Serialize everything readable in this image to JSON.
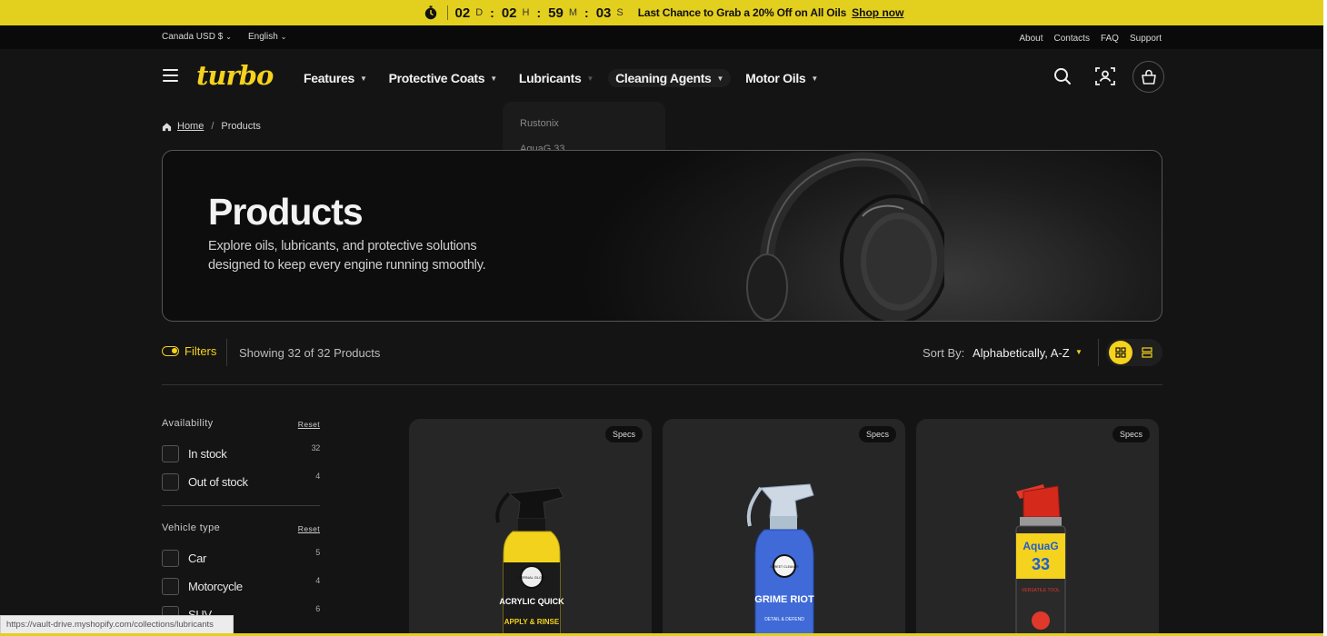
{
  "announcement": {
    "days": "02",
    "days_unit": "D",
    "hours": "02",
    "hours_unit": "H",
    "minutes": "59",
    "minutes_unit": "M",
    "seconds": "03",
    "seconds_unit": "S",
    "message": "Last Chance to Grab a 20% Off on All Oils",
    "cta": "Shop now"
  },
  "utility": {
    "currency": "Canada USD $",
    "language": "English",
    "links": [
      "About",
      "Contacts",
      "FAQ",
      "Support"
    ]
  },
  "nav": {
    "logo": "turbo",
    "items": [
      "Features",
      "Protective Coats",
      "Lubricants",
      "Cleaning Agents",
      "Motor Oils"
    ],
    "dropdown": [
      "Rustonix",
      "AquaG 33"
    ]
  },
  "breadcrumb": {
    "home": "Home",
    "separator": "/",
    "current": "Products"
  },
  "hero": {
    "title": "Products",
    "description": "Explore oils, lubricants, and protective solutions designed to keep every engine running smoothly."
  },
  "toolbar": {
    "filters_label": "Filters",
    "showing": "Showing 32 of 32 Products",
    "sort_label": "Sort By:",
    "sort_value": "Alphabetically, A-Z"
  },
  "filters": [
    {
      "title": "Availability",
      "reset": "Reset",
      "options": [
        {
          "label": "In stock",
          "count": "32"
        },
        {
          "label": "Out of stock",
          "count": "4"
        }
      ]
    },
    {
      "title": "Vehicle type",
      "reset": "Reset",
      "options": [
        {
          "label": "Car",
          "count": "5"
        },
        {
          "label": "Motorcycle",
          "count": "4"
        },
        {
          "label": "SUV",
          "count": "6"
        }
      ]
    }
  ],
  "products": [
    {
      "badge": "Specs",
      "brand_text": "ETERNAL GLOSS",
      "name_text": "ACRYLIC QUICK",
      "tag_text": "APPLY & RINSE",
      "color": "#f2d21c"
    },
    {
      "badge": "Specs",
      "brand_text": "STREET CLEANER",
      "name_text": "GRIME RIOT",
      "tag_text": "DETAIL & DEFEND",
      "color": "#3f6ad8"
    },
    {
      "badge": "Specs",
      "brand_text": "AquaG",
      "name_text": "33",
      "tag_text": "VERSATILE TOOL",
      "color": "#e0382a"
    }
  ],
  "status_url": "https://vault-drive.myshopify.com/collections/lubricants",
  "colors": {
    "accent": "#f4d21d",
    "background": "#141414",
    "card": "#262626"
  }
}
